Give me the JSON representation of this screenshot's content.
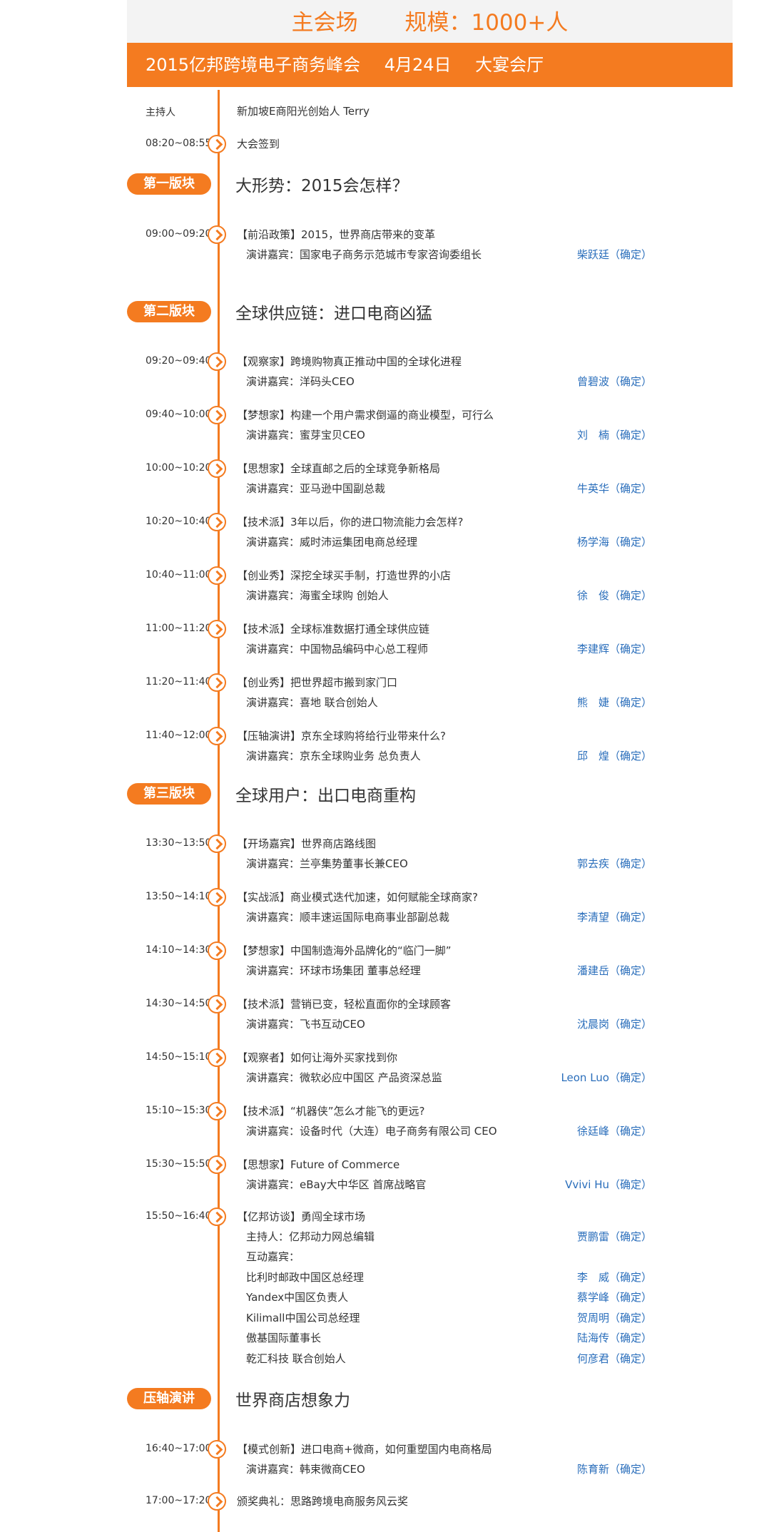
{
  "header": {
    "venue": "主会场",
    "scale": "规模：1000+人",
    "event": "2015亿邦跨境电子商务峰会",
    "date": "4月24日",
    "hall": "大宴会厅"
  },
  "host": {
    "label": "主持人",
    "name": "新加坡E商阳光创始人 Terry"
  },
  "checkin": {
    "time": "08:20~08:55",
    "text": "大会签到"
  },
  "sections": [
    {
      "badge": "第一版块",
      "title": "大形势：2015会怎样？"
    },
    {
      "badge": "第二版块",
      "title": "全球供应链：进口电商凶猛"
    },
    {
      "badge": "第三版块",
      "title": "全球用户：出口电商重构"
    },
    {
      "badge": "压轴演讲",
      "title": "世界商店想象力"
    }
  ],
  "sessions": [
    {
      "time": "09:00~09:20",
      "topic": "【前沿政策】2015，世界商店带来的变革",
      "role": "演讲嘉宾：国家电子商务示范城市专家咨询委组长",
      "speaker": "柴跃廷（确定）"
    },
    {
      "time": "09:20~09:40",
      "topic": "【观察家】跨境购物真正推动中国的全球化进程",
      "role": "演讲嘉宾：洋码头CEO",
      "speaker": "曾碧波（确定）"
    },
    {
      "time": "09:40~10:00",
      "topic": "【梦想家】构建一个用户需求倒逼的商业模型，可行么",
      "role": "演讲嘉宾：蜜芽宝贝CEO",
      "speaker": "刘　楠（确定）"
    },
    {
      "time": "10:00~10:20",
      "topic": "【思想家】全球直邮之后的全球竞争新格局",
      "role": "演讲嘉宾：亚马逊中国副总裁",
      "speaker": "牛英华（确定）"
    },
    {
      "time": "10:20~10:40",
      "topic": "【技术派】3年以后，你的进口物流能力会怎样?",
      "role": "演讲嘉宾：威时沛运集团电商总经理",
      "speaker": "杨学海（确定）"
    },
    {
      "time": "10:40~11:00",
      "topic": "【创业秀】深挖全球买手制，打造世界的小店",
      "role": "演讲嘉宾：海蜜全球购 创始人",
      "speaker": "徐　俊（确定）"
    },
    {
      "time": "11:00~11:20",
      "topic": "【技术派】全球标准数据打通全球供应链",
      "role": "演讲嘉宾：中国物品编码中心总工程师",
      "speaker": "李建辉（确定）"
    },
    {
      "time": "11:20~11:40",
      "topic": "【创业秀】把世界超市搬到家门口",
      "role": "演讲嘉宾：喜地 联合创始人",
      "speaker": "熊　婕（确定）"
    },
    {
      "time": "11:40~12:00",
      "topic": "【压轴演讲】京东全球购将给行业带来什么?",
      "role": "演讲嘉宾：京东全球购业务 总负责人",
      "speaker": "邱　煌（确定）"
    },
    {
      "time": "13:30~13:50",
      "topic": "【开场嘉宾】世界商店路线图",
      "role": "演讲嘉宾：兰亭集势董事长兼CEO",
      "speaker": "郭去疾（确定）"
    },
    {
      "time": "13:50~14:10",
      "topic": "【实战派】商业模式迭代加速，如何赋能全球商家?",
      "role": "演讲嘉宾：顺丰速运国际电商事业部副总裁",
      "speaker": "李清望（确定）"
    },
    {
      "time": "14:10~14:30",
      "topic": "【梦想家】中国制造海外品牌化的“临门一脚”",
      "role": "演讲嘉宾：环球市场集团 董事总经理",
      "speaker": "潘建岳（确定）"
    },
    {
      "time": "14:30~14:50",
      "topic": "【技术派】营销已变，轻松直面你的全球顾客",
      "role": "演讲嘉宾：飞书互动CEO",
      "speaker": "沈晨岗（确定）"
    },
    {
      "time": "14:50~15:10",
      "topic": "【观察者】如何让海外买家找到你",
      "role": "演讲嘉宾：微软必应中国区 产品资深总监",
      "speaker": "Leon Luo（确定）"
    },
    {
      "time": "15:10~15:30",
      "topic": "【技术派】“机器侠”怎么才能飞的更远?",
      "role": "演讲嘉宾：设备时代（大连）电子商务有限公司 CEO",
      "speaker": "徐廷峰（确定）"
    },
    {
      "time": "15:30~15:50",
      "topic": "【思想家】Future of Commerce",
      "role": "演讲嘉宾：eBay大中华区 首席战略官",
      "speaker": "Vvivi Hu（确定）"
    },
    {
      "time": "16:40~17:00",
      "topic": "【模式创新】进口电商+微商，如何重塑国内电商格局",
      "role": "演讲嘉宾：韩束微商CEO",
      "speaker": "陈育新（确定）"
    }
  ],
  "panel": {
    "time": "15:50~16:40",
    "topic": "【亿邦访谈】勇闯全球市场",
    "host_role": "主持人：亿邦动力网总编辑",
    "host_speaker": "贾鹏雷（确定）",
    "interact": "互动嘉宾：",
    "guests": [
      {
        "role": "比利时邮政中国区总经理",
        "speaker": "李　威（确定）"
      },
      {
        "role": "Yandex中国区负责人",
        "speaker": "蔡学峰（确定）"
      },
      {
        "role": "Kilimall中国公司总经理",
        "speaker": "贺周明（确定）"
      },
      {
        "role": "傲基国际董事长",
        "speaker": "陆海传（确定）"
      },
      {
        "role": "乾汇科技 联合创始人",
        "speaker": "何彦君（确定）"
      }
    ]
  },
  "award": {
    "time": "17:00~17:20",
    "text": "颁奖典礼：思路跨境电商服务风云奖"
  }
}
